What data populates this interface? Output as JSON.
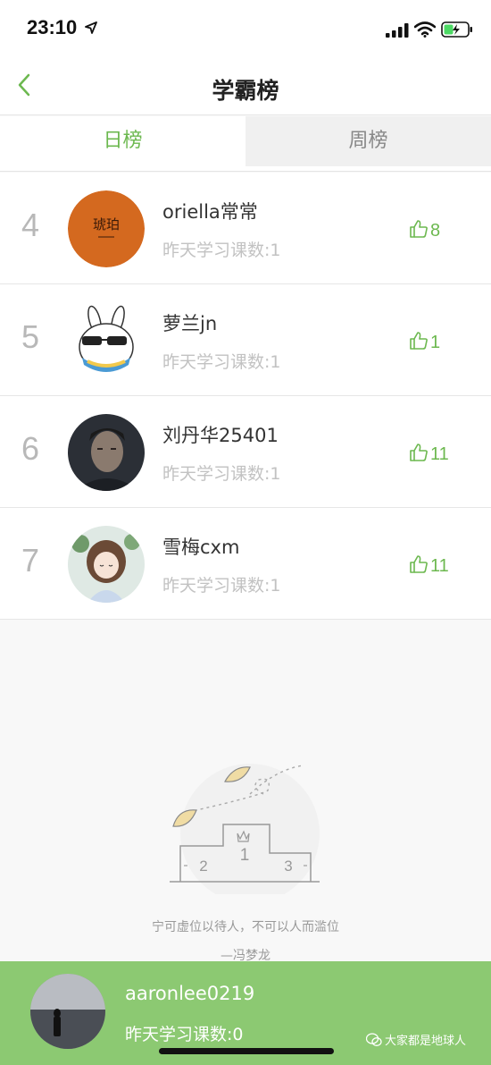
{
  "status_bar": {
    "time": "23:10"
  },
  "nav": {
    "title": "学霸榜"
  },
  "tabs": {
    "day_label": "日榜",
    "week_label": "周榜",
    "selected": "日榜"
  },
  "colors": {
    "accent": "#6cb84f",
    "footer": "#8cc972",
    "rank_number": "#b8b8b8"
  },
  "ranks": [
    {
      "rank": "4",
      "name": "oriella常常",
      "study": "昨天学习课数:1",
      "likes": "8",
      "avatar_text": "琥珀"
    },
    {
      "rank": "5",
      "name": "萝兰jn",
      "study": "昨天学习课数:1",
      "likes": "1"
    },
    {
      "rank": "6",
      "name": "刘丹华25401",
      "study": "昨天学习课数:1",
      "likes": "11"
    },
    {
      "rank": "7",
      "name": "雪梅cxm",
      "study": "昨天学习课数:1",
      "likes": "11"
    }
  ],
  "podium": {
    "left": "2",
    "center": "1",
    "right": "3"
  },
  "quote": {
    "text": "宁可虚位以待人，不可以人而滥位",
    "author": "—冯梦龙"
  },
  "me": {
    "name": "aaronlee0219",
    "study": "昨天学习课数:0"
  },
  "watermark": "大家都是地球人"
}
